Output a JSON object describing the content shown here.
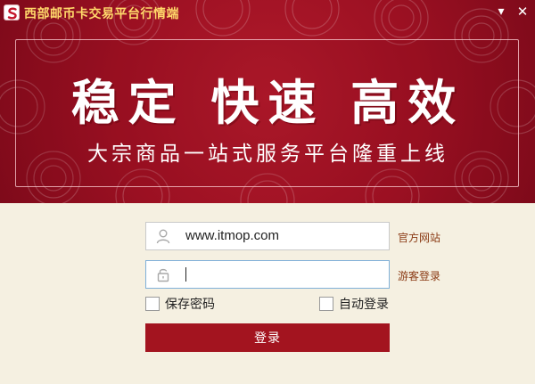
{
  "app": {
    "title": "西部邮币卡交易平台行情端",
    "logo_icon": "app-logo-icon"
  },
  "window_controls": {
    "minimize_symbol": "▾",
    "close_symbol": "✕"
  },
  "banner": {
    "headline": "稳定 快速 高效",
    "subline": "大宗商品一站式服务平台隆重上线"
  },
  "login": {
    "username_value": "www.itmop.com",
    "username_icon": "user-icon",
    "password_value": "",
    "password_icon": "lock-icon",
    "official_site_link": "官方网站",
    "guest_login_link": "游客登录",
    "save_password_label": "保存密码",
    "auto_login_label": "自动登录",
    "submit_label": "登录"
  },
  "colors": {
    "banner_red": "#9b1022",
    "title_yellow": "#ffd86a",
    "button_red": "#a3141f",
    "form_background": "#f5f0e1",
    "link_brown": "#8a3a14"
  }
}
